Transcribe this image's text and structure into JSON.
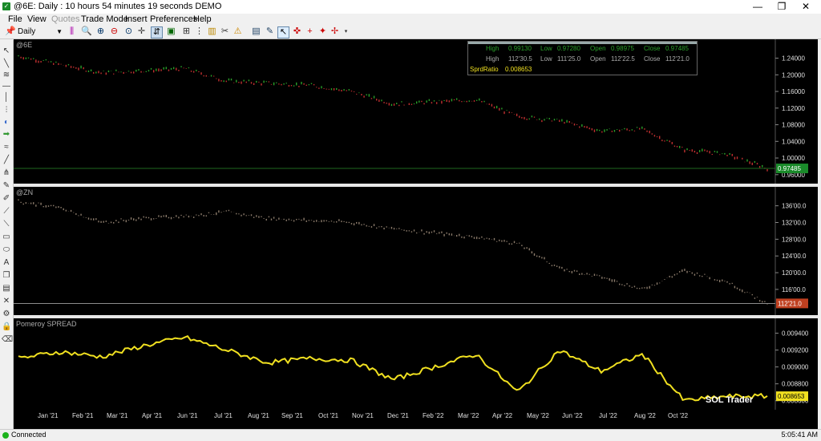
{
  "window": {
    "title": "@6E: Daily : 10 hours 54 minutes 19 seconds DEMO"
  },
  "menu": [
    {
      "label": "File",
      "disabled": false
    },
    {
      "label": "View",
      "disabled": false
    },
    {
      "label": "Quotes",
      "disabled": true
    },
    {
      "label": "Trade Mode",
      "disabled": false
    },
    {
      "label": "Insert",
      "disabled": false
    },
    {
      "label": "Preferences",
      "disabled": false
    },
    {
      "label": "Help",
      "disabled": false
    }
  ],
  "toolbar": {
    "interval": "Daily"
  },
  "panes": {
    "p1": {
      "label": "@6E",
      "last_price": "0.97485",
      "ticks": [
        "1.24000",
        "1.20000",
        "1.16000",
        "1.12000",
        "1.08000",
        "1.04000",
        "1.00000",
        "0.96000"
      ],
      "last_color": "#1a8a2a"
    },
    "p2": {
      "label": "@ZN",
      "last_price": "112'21.0",
      "ticks": [
        "136'00.0",
        "132'00.0",
        "128'00.0",
        "124'00.0",
        "120'00.0",
        "116'00.0"
      ],
      "last_color": "#c04020"
    },
    "p3": {
      "label": "Pomeroy SPREAD",
      "last_price": "0.008653",
      "ticks": [
        "0.009400",
        "0.009200",
        "0.009000",
        "0.008800",
        "0.008600"
      ],
      "last_color": "#f0e020"
    }
  },
  "infobox": {
    "row1": {
      "high_label": "High",
      "high": "0.99130",
      "low_label": "Low",
      "low": "0.97280",
      "open_label": "Open",
      "open": "0.98975",
      "close_label": "Close",
      "close": "0.97485"
    },
    "row2": {
      "high_label": "High",
      "high": "112'30.5",
      "low_label": "Low",
      "low": "111'25.0",
      "open_label": "Open",
      "open": "112'22.5",
      "close_label": "Close",
      "close": "112'21.0"
    },
    "row3": {
      "label": "SprdRatio",
      "value": "0.008653"
    }
  },
  "xaxis": [
    "Jan '21",
    "Feb '21",
    "Mar '21",
    "Apr '21",
    "Jun '21",
    "Jul '21",
    "Aug '21",
    "Sep '21",
    "Oct '21",
    "Nov '21",
    "Dec '21",
    "Feb '22",
    "Mar '22",
    "Apr '22",
    "May '22",
    "Jun '22",
    "Jul '22",
    "Aug '22",
    "Oct '22"
  ],
  "watermark": "SOL Trader",
  "status": {
    "text": "Connected",
    "clock": "5:05:41 AM"
  },
  "colors": {
    "spread_line": "#f0e020",
    "bull": "#2aa02a",
    "bear": "#c03030",
    "zn_bar": "#8a7a6a"
  },
  "chart_data": [
    {
      "type": "line",
      "title": "@6E",
      "x": [
        "Jan '21",
        "Feb '21",
        "Mar '21",
        "Apr '21",
        "Jun '21",
        "Jul '21",
        "Aug '21",
        "Sep '21",
        "Oct '21",
        "Nov '21",
        "Dec '21",
        "Feb '22",
        "Mar '22",
        "Apr '22",
        "May '22",
        "Jun '22",
        "Jul '22",
        "Aug '22",
        "Oct '22"
      ],
      "values": [
        1.245,
        1.225,
        1.205,
        1.21,
        1.215,
        1.185,
        1.18,
        1.175,
        1.16,
        1.13,
        1.135,
        1.14,
        1.1,
        1.09,
        1.065,
        1.07,
        1.02,
        1.01,
        0.975
      ],
      "ylim": [
        0.95,
        1.27
      ]
    },
    {
      "type": "line",
      "title": "@ZN",
      "x": [
        "Jan '21",
        "Feb '21",
        "Mar '21",
        "Apr '21",
        "Jun '21",
        "Jul '21",
        "Aug '21",
        "Sep '21",
        "Oct '21",
        "Nov '21",
        "Dec '21",
        "Feb '22",
        "Mar '22",
        "Apr '22",
        "May '22",
        "Jun '22",
        "Jul '22",
        "Aug '22",
        "Oct '22"
      ],
      "values": [
        137.0,
        135.5,
        132.0,
        133.0,
        133.5,
        134.5,
        133.0,
        132.5,
        132.0,
        130.5,
        129.5,
        128.5,
        127.0,
        121.0,
        119.0,
        116.0,
        120.5,
        118.0,
        112.65
      ],
      "ylim": [
        111,
        139
      ]
    },
    {
      "type": "line",
      "title": "Pomeroy SPREAD",
      "x": [
        "Jan '21",
        "Feb '21",
        "Mar '21",
        "Apr '21",
        "Jun '21",
        "Jul '21",
        "Aug '21",
        "Sep '21",
        "Oct '21",
        "Nov '21",
        "Dec '21",
        "Feb '22",
        "Mar '22",
        "Apr '22",
        "May '22",
        "Jun '22",
        "Jul '22",
        "Aug '22",
        "Oct '22"
      ],
      "values": [
        0.0091,
        0.00918,
        0.00912,
        0.00925,
        0.00935,
        0.0092,
        0.00905,
        0.0091,
        0.00908,
        0.00885,
        0.009,
        0.00915,
        0.0087,
        0.0092,
        0.00895,
        0.00915,
        0.0086,
        0.00865,
        0.008653
      ],
      "ylim": [
        0.00855,
        0.0095
      ]
    }
  ]
}
